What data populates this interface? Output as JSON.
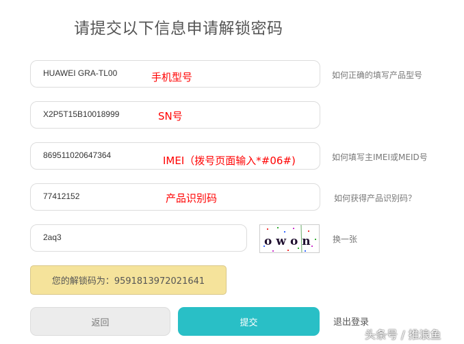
{
  "title": "请提交以下信息申请解锁密码",
  "fields": [
    {
      "value": "HUAWEI GRA-TL00",
      "annotation": "手机型号",
      "help": "如何正确的填写产品型号"
    },
    {
      "value": "X2P5T15B10018999",
      "annotation": "SN号",
      "help": ""
    },
    {
      "value": "869511020647364",
      "annotation": "IMEI（拨号页面输入*#06#)",
      "help": "如何填写主IMEI或MEID号"
    },
    {
      "value": "77412152",
      "annotation": "产品识别码",
      "help": "如何获得产品识别码？"
    }
  ],
  "captcha": {
    "value": "2aq3",
    "image_text": "owon",
    "refresh": "换一张"
  },
  "result": "您的解锁码为：9591813972021641",
  "buttons": {
    "back": "返回",
    "submit": "提交",
    "logout": "退出登录"
  },
  "watermark": "头条号 / 推浪鱼",
  "colors": {
    "accent": "#29bfc6",
    "result_bg": "#f5e39b",
    "annotation": "#ff0000"
  }
}
